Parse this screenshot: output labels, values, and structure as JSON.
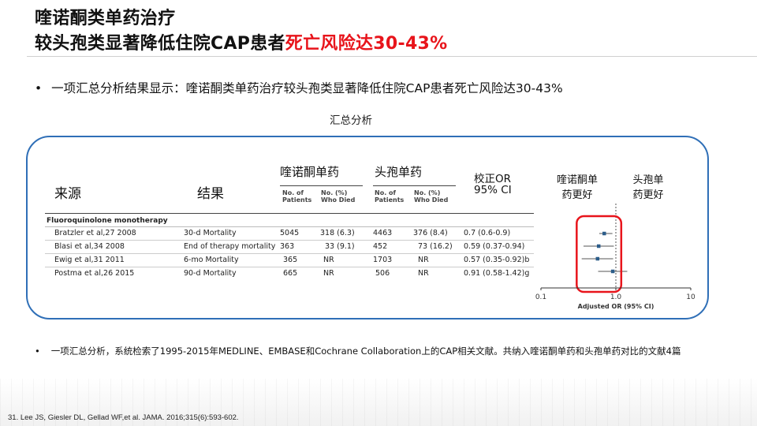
{
  "title": {
    "line1": "喹诺酮类单药治疗",
    "line2_prefix": "较头孢类显著降低住院CAP患者",
    "line2_highlight": "死亡风险达30-43%"
  },
  "bullet_main": "一项汇总分析结果显示：喹诺酮类单药治疗较头孢类显著降低住院CAP患者死亡风险达30-43%",
  "pooled_label": "汇总分析",
  "table": {
    "overlay": {
      "source": "来源",
      "outcome": "结果",
      "quinolone": "喹诺酮单药",
      "cephalosporin": "头孢单药",
      "adj_or_line1": "校正OR",
      "adj_or_line2": "95% CI"
    },
    "subheaders": {
      "no_patients": "No. of Patients",
      "pct_died": "No. (%) Who Died"
    },
    "section": "Fluoroquinolone monotherapy",
    "rows": [
      {
        "source": "Bratzler et al,27 2008",
        "outcome": "30-d Mortality",
        "q_n": "5045",
        "q_d": "318 (6.3)",
        "c_n": "4463",
        "c_d": "376 (8.4)",
        "or": "0.7 (0.6-0.9)"
      },
      {
        "source": "Blasi et al,34 2008",
        "outcome": "End of therapy mortality",
        "q_n": "363",
        "q_d": "33 (9.1)",
        "c_n": "452",
        "c_d": "73 (16.2)",
        "or": "0.59 (0.37-0.94)"
      },
      {
        "source": "Ewig et al,31 2011",
        "outcome": "6-mo Mortality",
        "q_n": "365",
        "q_d": "NR",
        "c_n": "1703",
        "c_d": "NR",
        "or": "0.57 (0.35-0.92)b"
      },
      {
        "source": "Postma et al,26 2015",
        "outcome": "90-d Mortality",
        "q_n": "665",
        "q_d": "NR",
        "c_n": "506",
        "c_d": "NR",
        "or": "0.91 (0.58-1.42)g"
      }
    ]
  },
  "forest": {
    "favors_quinolone_1": "喹诺酮单",
    "favors_quinolone_2": "药更好",
    "favors_ceph_1": "头孢单",
    "favors_ceph_2": "药更好"
  },
  "chart_data": {
    "type": "scatter",
    "xlabel": "Adjusted OR (95% CI)",
    "xscale": "log",
    "xlim": [
      0.1,
      10
    ],
    "xticks": [
      "0.1",
      "1.0",
      "10"
    ],
    "points": [
      {
        "or": 0.7,
        "lo": 0.6,
        "hi": 0.9
      },
      {
        "or": 0.59,
        "lo": 0.37,
        "hi": 0.94
      },
      {
        "or": 0.57,
        "lo": 0.35,
        "hi": 0.92
      },
      {
        "or": 0.91,
        "lo": 0.58,
        "hi": 1.42
      }
    ],
    "highlight_color": "#e8141b"
  },
  "footnote": "一项汇总分析，系统检索了1995-2015年MEDLINE、EMBASE和Cochrane Collaboration上的CAP相关文献。共纳入喹诺酮单药和头孢单药对比的文献4篇",
  "reference": "31. Lee JS, Giesler DL, Gellad WF,et al. JAMA. 2016;315(6):593-602."
}
